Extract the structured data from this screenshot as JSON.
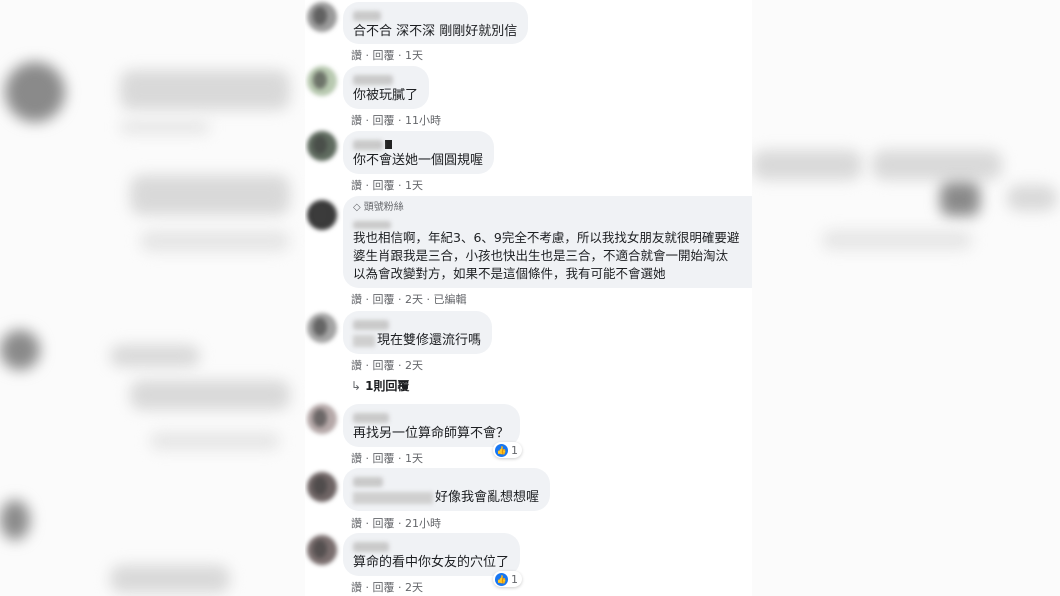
{
  "comments": [
    {
      "text": "合不合 深不深 剛剛好就別信",
      "actions": {
        "like": "讚",
        "sep": "·",
        "reply": "回覆",
        "time": "1天"
      }
    },
    {
      "text": "你被玩膩了",
      "actions": {
        "like": "讚",
        "sep": "·",
        "reply": "回覆",
        "time": "11小時"
      }
    },
    {
      "text": "你不會送她一個圓規喔",
      "actions": {
        "like": "讚",
        "sep": "·",
        "reply": "回覆",
        "time": "1天"
      }
    },
    {
      "badge": "頭號粉絲",
      "lines": [
        "我也相信啊，年紀3、6、9完全不考慮，所以我找女朋友就很明確要避",
        "婆生肖跟我是三合，小孩也快出生也是三合，不適合就會一開始淘汰",
        "以為會改變對方，如果不是這個條件，我有可能不會選她"
      ],
      "actions": {
        "like": "讚",
        "sep": "·",
        "reply": "回覆",
        "time": "2天",
        "edited": "已編輯"
      }
    },
    {
      "text": "現在雙修還流行嗎",
      "actions": {
        "like": "讚",
        "sep": "·",
        "reply": "回覆",
        "time": "2天"
      },
      "replies": "1則回覆"
    },
    {
      "text": "再找另一位算命師算不會？",
      "actions": {
        "like": "讚",
        "sep": "·",
        "reply": "回覆",
        "time": "1天"
      },
      "reaction_count": "1"
    },
    {
      "text": "好像我會亂想想喔",
      "actions": {
        "like": "讚",
        "sep": "·",
        "reply": "回覆",
        "time": "21小時"
      }
    },
    {
      "text": "算命的看中你女友的穴位了",
      "actions": {
        "like": "讚",
        "sep": "·",
        "reply": "回覆",
        "time": "2天"
      },
      "reaction_count": "1"
    }
  ],
  "icons": {
    "like": "like-icon",
    "badge": "diamond-icon",
    "reply_arrow": "reply-arrow-icon"
  }
}
